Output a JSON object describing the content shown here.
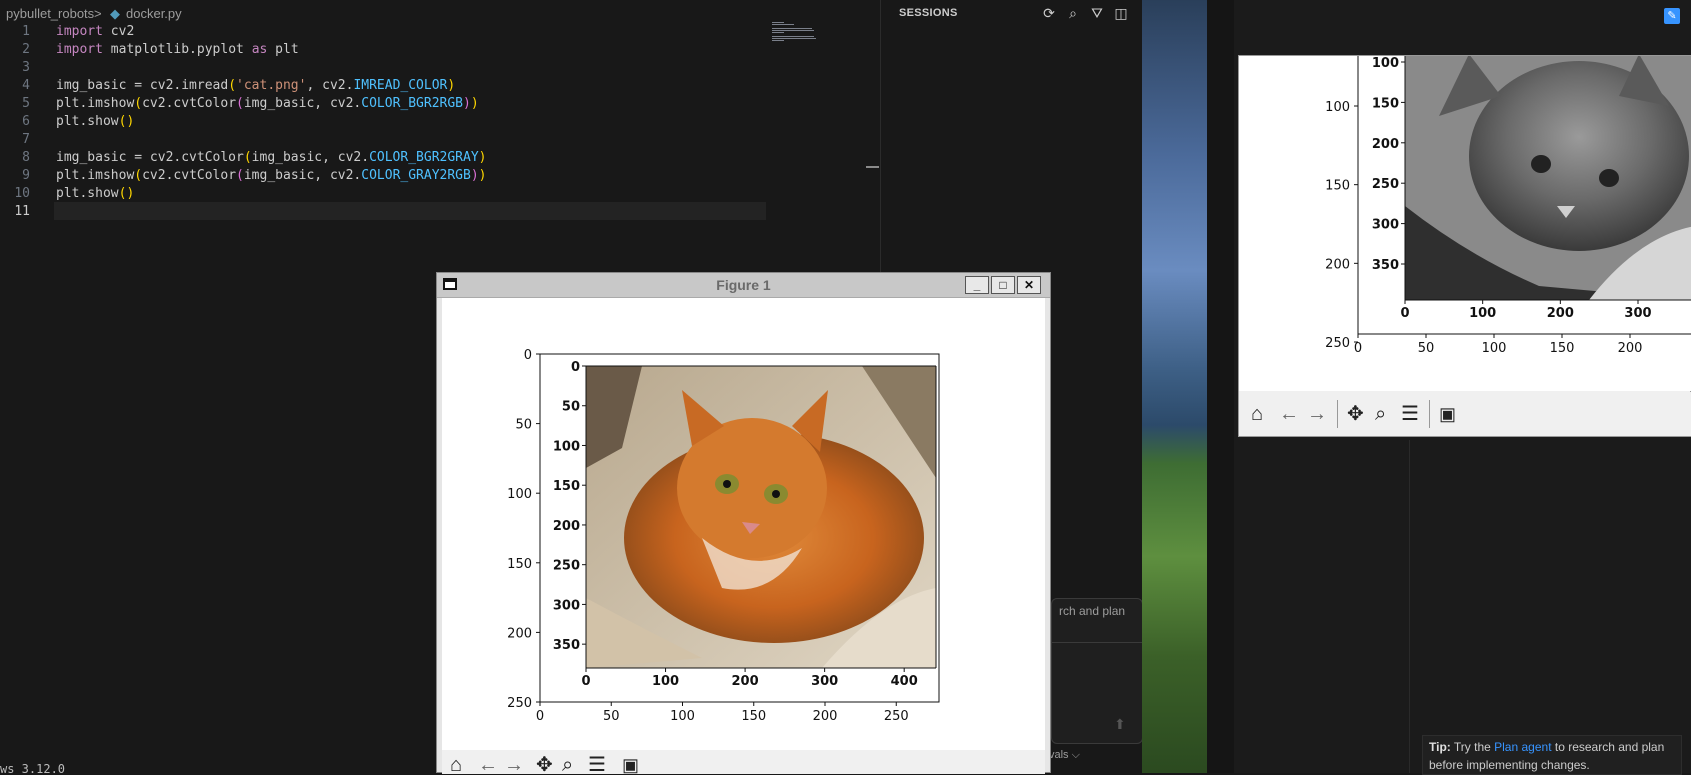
{
  "breadcrumb": {
    "folder": "pybullet_robots",
    "separator": ">",
    "file": "docker.py"
  },
  "code": [
    {
      "n": "1",
      "tokens": [
        [
          "kw",
          "import"
        ],
        [
          "t",
          " cv2"
        ]
      ]
    },
    {
      "n": "2",
      "tokens": [
        [
          "kw",
          "import"
        ],
        [
          "t",
          " matplotlib.pyplot "
        ],
        [
          "kw",
          "as"
        ],
        [
          "t",
          " plt"
        ]
      ]
    },
    {
      "n": "3",
      "tokens": []
    },
    {
      "n": "4",
      "tokens": [
        [
          "t",
          "img_basic = cv2.imread"
        ],
        [
          "p1",
          "("
        ],
        [
          "str",
          "'cat.png'"
        ],
        [
          "t",
          ", cv2."
        ],
        [
          "cst",
          "IMREAD_COLOR"
        ],
        [
          "p1",
          ")"
        ]
      ]
    },
    {
      "n": "5",
      "tokens": [
        [
          "t",
          "plt.imshow"
        ],
        [
          "p1",
          "("
        ],
        [
          "t",
          "cv2.cvtColor"
        ],
        [
          "p2",
          "("
        ],
        [
          "t",
          "img_basic, cv2."
        ],
        [
          "cst",
          "COLOR_BGR2RGB"
        ],
        [
          "p2",
          ")"
        ],
        [
          "p1",
          ")"
        ]
      ]
    },
    {
      "n": "6",
      "tokens": [
        [
          "t",
          "plt.show"
        ],
        [
          "p1",
          "()"
        ]
      ]
    },
    {
      "n": "7",
      "tokens": []
    },
    {
      "n": "8",
      "tokens": [
        [
          "t",
          "img_basic = cv2.cvtColor"
        ],
        [
          "p1",
          "("
        ],
        [
          "t",
          "img_basic, cv2."
        ],
        [
          "cst",
          "COLOR_BGR2GRAY"
        ],
        [
          "p1",
          ")"
        ]
      ]
    },
    {
      "n": "9",
      "tokens": [
        [
          "t",
          "plt.imshow"
        ],
        [
          "p1",
          "("
        ],
        [
          "t",
          "cv2.cvtColor"
        ],
        [
          "p2",
          "("
        ],
        [
          "t",
          "img_basic, cv2."
        ],
        [
          "cst",
          "COLOR_GRAY2RGB"
        ],
        [
          "p2",
          ")"
        ],
        [
          "p1",
          ")"
        ]
      ]
    },
    {
      "n": "10",
      "tokens": [
        [
          "t",
          "plt.show"
        ],
        [
          "p1",
          "()"
        ]
      ]
    },
    {
      "n": "11",
      "tokens": []
    }
  ],
  "active_line": "11",
  "status_fragment": "ws 3.12.0",
  "sessions": {
    "title": "SESSIONS",
    "chat_hint": "rch and plan",
    "evals_label": "vals ⌵"
  },
  "tip": {
    "label": "Tip:",
    "pre": " Try the ",
    "link": "Plan agent",
    "post": " to research and plan before implementing changes."
  },
  "figure1": {
    "title": "Figure 1",
    "x_ticks": [
      "0",
      "50",
      "100",
      "150",
      "200",
      "250"
    ],
    "y_ticks": [
      "0",
      "50",
      "100",
      "150",
      "200",
      "250"
    ],
    "inner_x_ticks": [
      "0",
      "100",
      "200",
      "300",
      "400"
    ],
    "inner_y_ticks": [
      "0",
      "50",
      "100",
      "150",
      "200",
      "250",
      "300",
      "350"
    ],
    "image_desc": "orange tabby cat lying on a beige blanket"
  },
  "figure2": {
    "outer_y_ticks": [
      "100",
      "150",
      "200",
      "250"
    ],
    "outer_x_ticks": [
      "0",
      "50",
      "100",
      "150",
      "200"
    ],
    "inner_y_ticks": [
      "100",
      "150",
      "200",
      "250",
      "300",
      "350"
    ],
    "inner_x_ticks": [
      "0",
      "100",
      "200",
      "300"
    ],
    "image_desc": "grayscale cat image"
  },
  "chart_data": [
    {
      "type": "image",
      "title": "",
      "outer_axes": {
        "xlim": [
          0,
          280
        ],
        "ylim": [
          250,
          0
        ],
        "x_ticks": [
          0,
          50,
          100,
          150,
          200,
          250
        ],
        "y_ticks": [
          0,
          50,
          100,
          150,
          200,
          250
        ]
      },
      "inner_axes": {
        "x_ticks": [
          0,
          100,
          200,
          300,
          400
        ],
        "y_ticks": [
          0,
          50,
          100,
          150,
          200,
          250,
          300,
          350
        ]
      }
    },
    {
      "type": "image",
      "title": "",
      "outer_axes": {
        "x_ticks": [
          0,
          50,
          100,
          150,
          200
        ],
        "y_ticks": [
          100,
          150,
          200,
          250
        ]
      },
      "inner_axes": {
        "x_ticks": [
          0,
          100,
          200,
          300
        ],
        "y_ticks": [
          100,
          150,
          200,
          250,
          300,
          350
        ]
      }
    }
  ],
  "icons": {
    "refresh": "⟳",
    "search": "🔍",
    "filter": "⛛",
    "panel": "◫",
    "home": "⌂",
    "back": "←",
    "forward": "→",
    "pan": "✥",
    "zoom": "🔍",
    "configure": "☰",
    "save": "💾"
  }
}
